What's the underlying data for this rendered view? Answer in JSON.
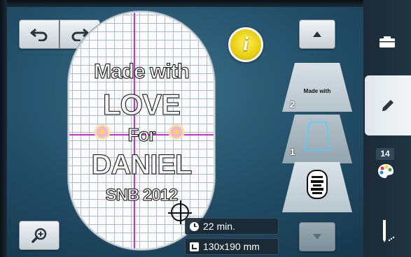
{
  "toolbar": {
    "undo_icon": "undo-arrow-icon",
    "redo_icon": "redo-arrow-icon",
    "zoom_icon": "zoom-in-icon",
    "info_label": "i"
  },
  "design": {
    "lines": [
      "Made with",
      "LOVE",
      "For",
      "DANIEL",
      "SNB 2012"
    ],
    "grid_color": "#9fb2c8",
    "axis_color": "#d42bd4"
  },
  "status": {
    "time": "22 min.",
    "size": "130x190 mm"
  },
  "layers": [
    {
      "number": "2",
      "thumbnail_text": "Made with"
    },
    {
      "number": "1",
      "thumbnail_text": ""
    },
    {
      "number": "",
      "thumbnail_text": ""
    }
  ],
  "sidebar": {
    "thread_count": "14",
    "tabs": [
      "folder-icon",
      "pencil-icon",
      "color-palette-icon",
      "needle-icon"
    ]
  },
  "colors": {
    "accent_yellow": "#e8cf10",
    "background": "#24506a"
  }
}
